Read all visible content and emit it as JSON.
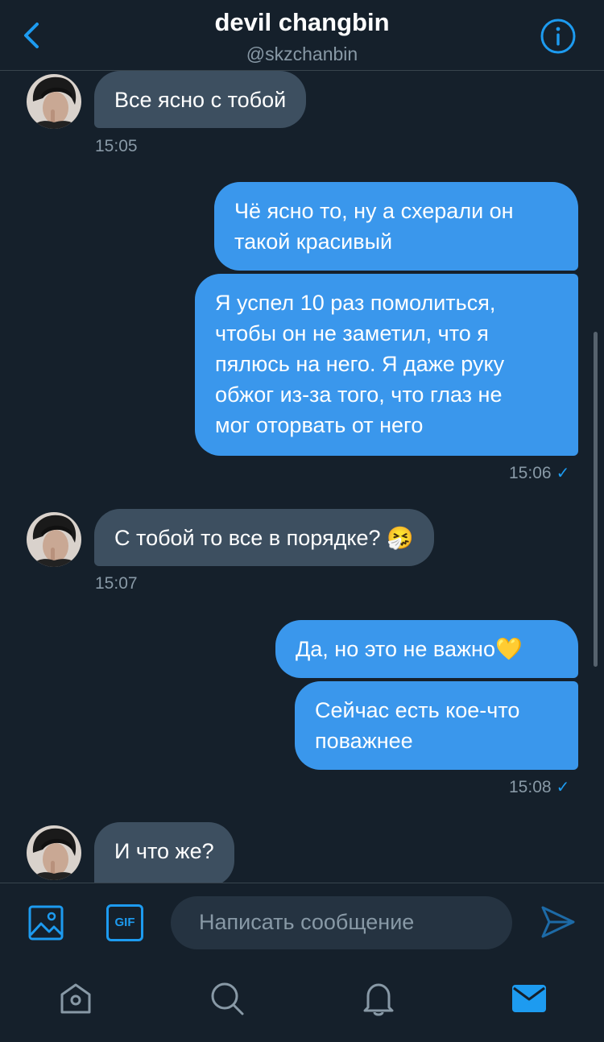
{
  "header": {
    "title": "devil changbin",
    "handle": "@skzchanbin",
    "back_icon": "chevron-left-icon",
    "info_icon": "info-icon"
  },
  "messages": [
    {
      "direction": "in",
      "lines": [
        "Все ясно с тобой"
      ],
      "time": "15:05"
    },
    {
      "direction": "out",
      "lines": [
        "Чё ясно то, ну а схерали он",
        "такой красивый"
      ]
    },
    {
      "direction": "out",
      "lines": [
        "Я успел 10 раз помолиться,",
        "чтобы он не заметил, что я",
        "пялюсь на него. Я даже руку",
        "обжог из-за того, что глаз не",
        "мог оторвать от него"
      ],
      "time": "15:06"
    },
    {
      "direction": "in",
      "lines": [
        "С тобой то все в порядке? 🤧"
      ],
      "time": "15:07"
    },
    {
      "direction": "out",
      "lines": [
        "Да, но это не важно💛"
      ]
    },
    {
      "direction": "out",
      "lines": [
        "Сейчас есть кое-что",
        "поважнее"
      ],
      "time": "15:08"
    },
    {
      "direction": "in",
      "lines": [
        "И что же?"
      ]
    }
  ],
  "read_receipt": "✓",
  "composer": {
    "placeholder": "Написать сообщение",
    "image_icon": "image-icon",
    "gif_label": "GIF",
    "send_icon": "send-icon"
  },
  "tabs": [
    "home-icon",
    "search-icon",
    "notifications-icon",
    "messages-icon"
  ],
  "colors": {
    "background": "#15202b",
    "incoming_bubble": "#3d4f60",
    "outgoing_bubble": "#3a97ec",
    "accent": "#1d9bf0",
    "muted_text": "#8899a6"
  }
}
